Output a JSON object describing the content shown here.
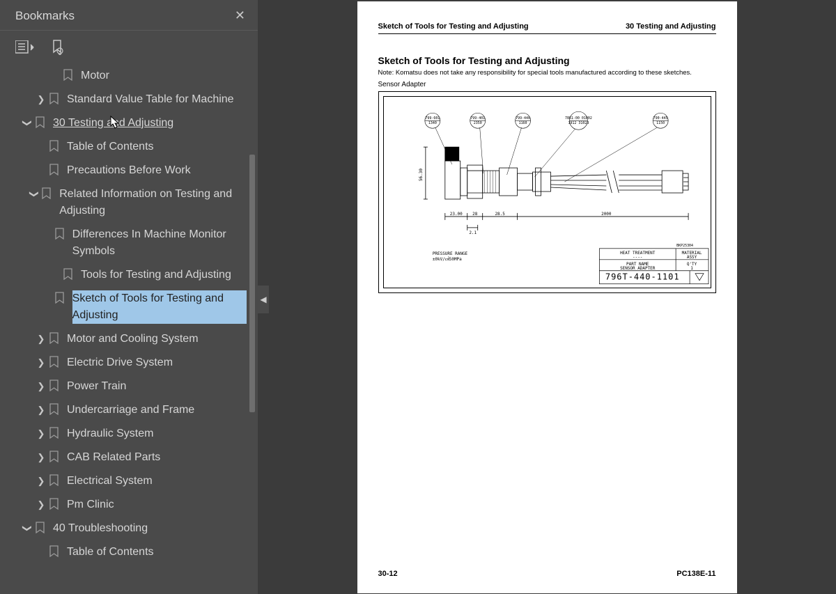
{
  "sidebar": {
    "title": "Bookmarks",
    "items": [
      {
        "level": 2,
        "arrow": "",
        "label": "Motor"
      },
      {
        "level": 1,
        "arrow": "right",
        "label": "Standard Value Table for Machine"
      },
      {
        "level": 0,
        "arrow": "down",
        "label": " 30 Testing and Adjusting",
        "underline": true
      },
      {
        "level": 1,
        "arrow": "",
        "label": "Table of Contents"
      },
      {
        "level": 1,
        "arrow": "",
        "label": "Precautions Before Work"
      },
      {
        "level": 1,
        "arrow": "down",
        "label": "Related Information on Testing and Adjusting"
      },
      {
        "level": 2,
        "arrow": "",
        "label": "Differences In Machine Monitor Symbols"
      },
      {
        "level": 2,
        "arrow": "",
        "label": "Tools for Testing and Adjusting"
      },
      {
        "level": 2,
        "arrow": "",
        "label": "Sketch of Tools for Testing and Adjusting",
        "selected": true
      },
      {
        "level": 1,
        "arrow": "right",
        "label": "Motor and Cooling System"
      },
      {
        "level": 1,
        "arrow": "right",
        "label": "Electric Drive System"
      },
      {
        "level": 1,
        "arrow": "right",
        "label": "Power Train"
      },
      {
        "level": 1,
        "arrow": "right",
        "label": "Undercarriage and Frame"
      },
      {
        "level": 1,
        "arrow": "right",
        "label": "Hydraulic System"
      },
      {
        "level": 1,
        "arrow": "right",
        "label": "CAB Related Parts"
      },
      {
        "level": 1,
        "arrow": "right",
        "label": "Electrical System"
      },
      {
        "level": 1,
        "arrow": "right",
        "label": "Pm Clinic"
      },
      {
        "level": 0,
        "arrow": "down",
        "label": "40 Troubleshooting"
      },
      {
        "level": 1,
        "arrow": "",
        "label": "Table of Contents"
      }
    ]
  },
  "page": {
    "header_left": "Sketch of Tools for Testing and Adjusting",
    "header_right": "30 Testing and Adjusting",
    "title": "Sketch of Tools for Testing and Adjusting",
    "note": "Note: Komatsu does not take any responsibility for special tools manufactured according to these sketches.",
    "label": "Sensor Adapter",
    "footer_left": "30-12",
    "footer_right": "PC138E-11",
    "diagram": {
      "callouts": [
        "799-601-1340",
        "799-401-2350",
        "799-440-1160",
        "7861-00-01002\n1912   31023",
        "790-445-1150"
      ],
      "dims": {
        "h": "56.30",
        "a": "23.00",
        "b": "28",
        "c": "28.5",
        "d": "2000",
        "e": "2.1"
      },
      "pressure": "PRESSURE RANGE\n±0kV/㎠50MPa",
      "part_no": "796T-440-1101",
      "table": {
        "heat": "HEAT TREATMENT\n----",
        "material": "MATERIAL\nASSY",
        "part": "PART NAME\nSENSOR ADAPTER",
        "qty": "Q'TY\n1"
      },
      "dwg": "BKP25304"
    }
  }
}
